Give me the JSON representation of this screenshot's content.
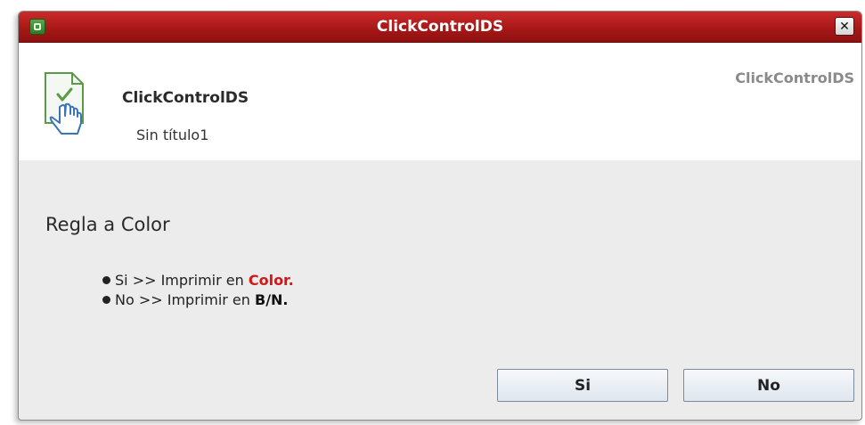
{
  "window": {
    "title": "ClickControlDS",
    "close_glyph": "✕"
  },
  "header": {
    "app_name": "ClickControlDS",
    "document_name": "Sin título1",
    "brand": "ClickControlDS",
    "icon": "document-hand-icon"
  },
  "body": {
    "title": "Regla a Color",
    "options": [
      {
        "prefix": "Si >> Imprimir en ",
        "emphasis": "Color.",
        "emphasis_color": "#d01818"
      },
      {
        "prefix": "No >> Imprimir en ",
        "emphasis": "B/N.",
        "emphasis_color": "#111111"
      }
    ]
  },
  "buttons": {
    "yes_label": "Si",
    "no_label": "No"
  },
  "colors": {
    "titlebar": "#b01c1c",
    "dialog_bg": "#ececec",
    "accent_red": "#d01818"
  }
}
